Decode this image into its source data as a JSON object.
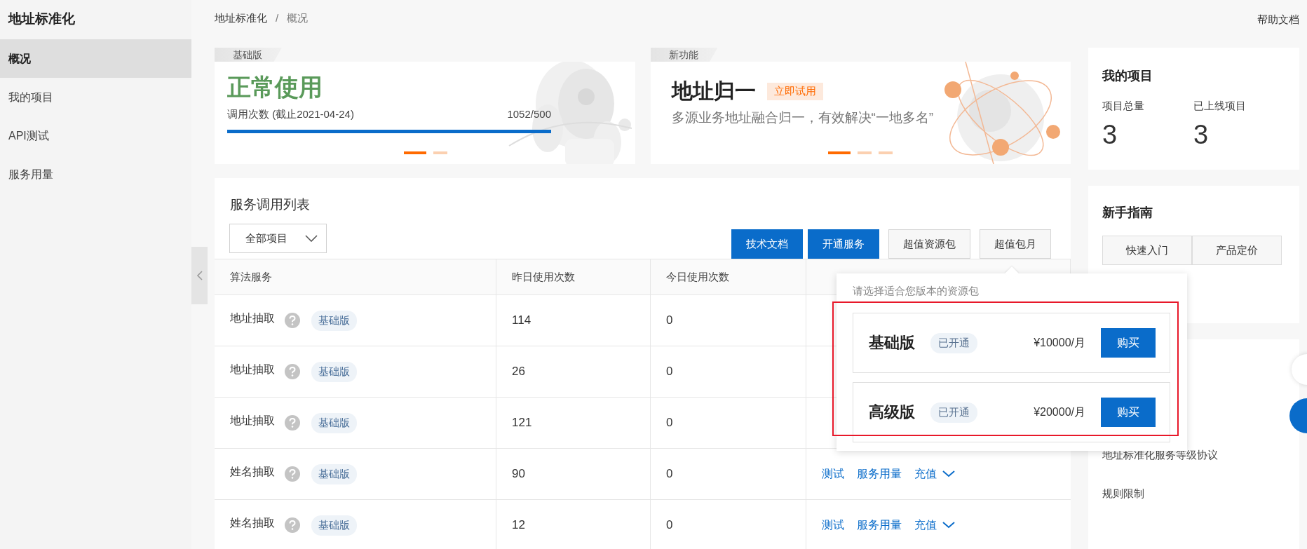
{
  "sidebar": {
    "title": "地址标准化",
    "items": [
      {
        "label": "概况",
        "selected": true
      },
      {
        "label": "我的项目",
        "selected": false
      },
      {
        "label": "API测试",
        "selected": false
      },
      {
        "label": "服务用量",
        "selected": false
      }
    ]
  },
  "breadcrumb": {
    "items": [
      "地址标准化",
      "概况"
    ],
    "separator": "/"
  },
  "help_link": "帮助文档",
  "banners": [
    {
      "kind": "usage",
      "tag": "基础版",
      "title": "正常使用",
      "caption": "调用次数  (截止2021-04-24)",
      "reading": "1052/500",
      "level": 1,
      "dots": [
        {
          "selected": true
        },
        {
          "selected": false
        }
      ]
    },
    {
      "kind": "feature",
      "tag": "新功能",
      "title": "地址归一",
      "badge": "立即试用",
      "subtitle": "多源业务地址融合归一，有效解决“一地多名”",
      "dots": [
        {
          "selected": true
        },
        {
          "selected": false
        },
        {
          "selected": false
        }
      ]
    }
  ],
  "service_list": {
    "title": "服务调用列表",
    "filter": "全部项目",
    "buttons": [
      {
        "label": "技术文档",
        "kind": "primary"
      },
      {
        "label": "开通服务",
        "kind": "primary"
      },
      {
        "label": "超值资源包",
        "kind": "default"
      },
      {
        "label": "超值包月",
        "kind": "default"
      }
    ],
    "columns": [
      "算法服务",
      "昨日使用次数",
      "今日使用次数"
    ],
    "rows": [
      {
        "service": "地址抽取",
        "tag": "基础版",
        "yesterday": "114",
        "today": "0",
        "actions": []
      },
      {
        "service": "地址抽取",
        "tag": "基础版",
        "yesterday": "26",
        "today": "0",
        "actions": []
      },
      {
        "service": "地址抽取",
        "tag": "基础版",
        "yesterday": "121",
        "today": "0",
        "actions": []
      },
      {
        "service": "姓名抽取",
        "tag": "基础版",
        "yesterday": "90",
        "today": "0",
        "actions": [
          "测试",
          "服务用量",
          "充值"
        ]
      },
      {
        "service": "姓名抽取",
        "tag": "基础版",
        "yesterday": "12",
        "today": "0",
        "actions": [
          "测试",
          "服务用量",
          "充值"
        ]
      }
    ]
  },
  "projects": {
    "title": "我的项目",
    "stats": [
      {
        "label": "项目总量",
        "value": "3"
      },
      {
        "label": "已上线项目",
        "value": "3"
      }
    ]
  },
  "guide": {
    "title": "新手指南",
    "buttons": [
      "快速入门",
      "产品定价"
    ]
  },
  "links": [
    "地址标准化服务等级协议",
    "规则限制"
  ],
  "popover": {
    "title": "请选择适合您版本的资源包",
    "plans": [
      {
        "name": "基础版",
        "status": "已开通",
        "price": "¥10000/月",
        "action": "购买"
      },
      {
        "name": "高级版",
        "status": "已开通",
        "price": "¥20000/月",
        "action": "购买"
      }
    ]
  }
}
